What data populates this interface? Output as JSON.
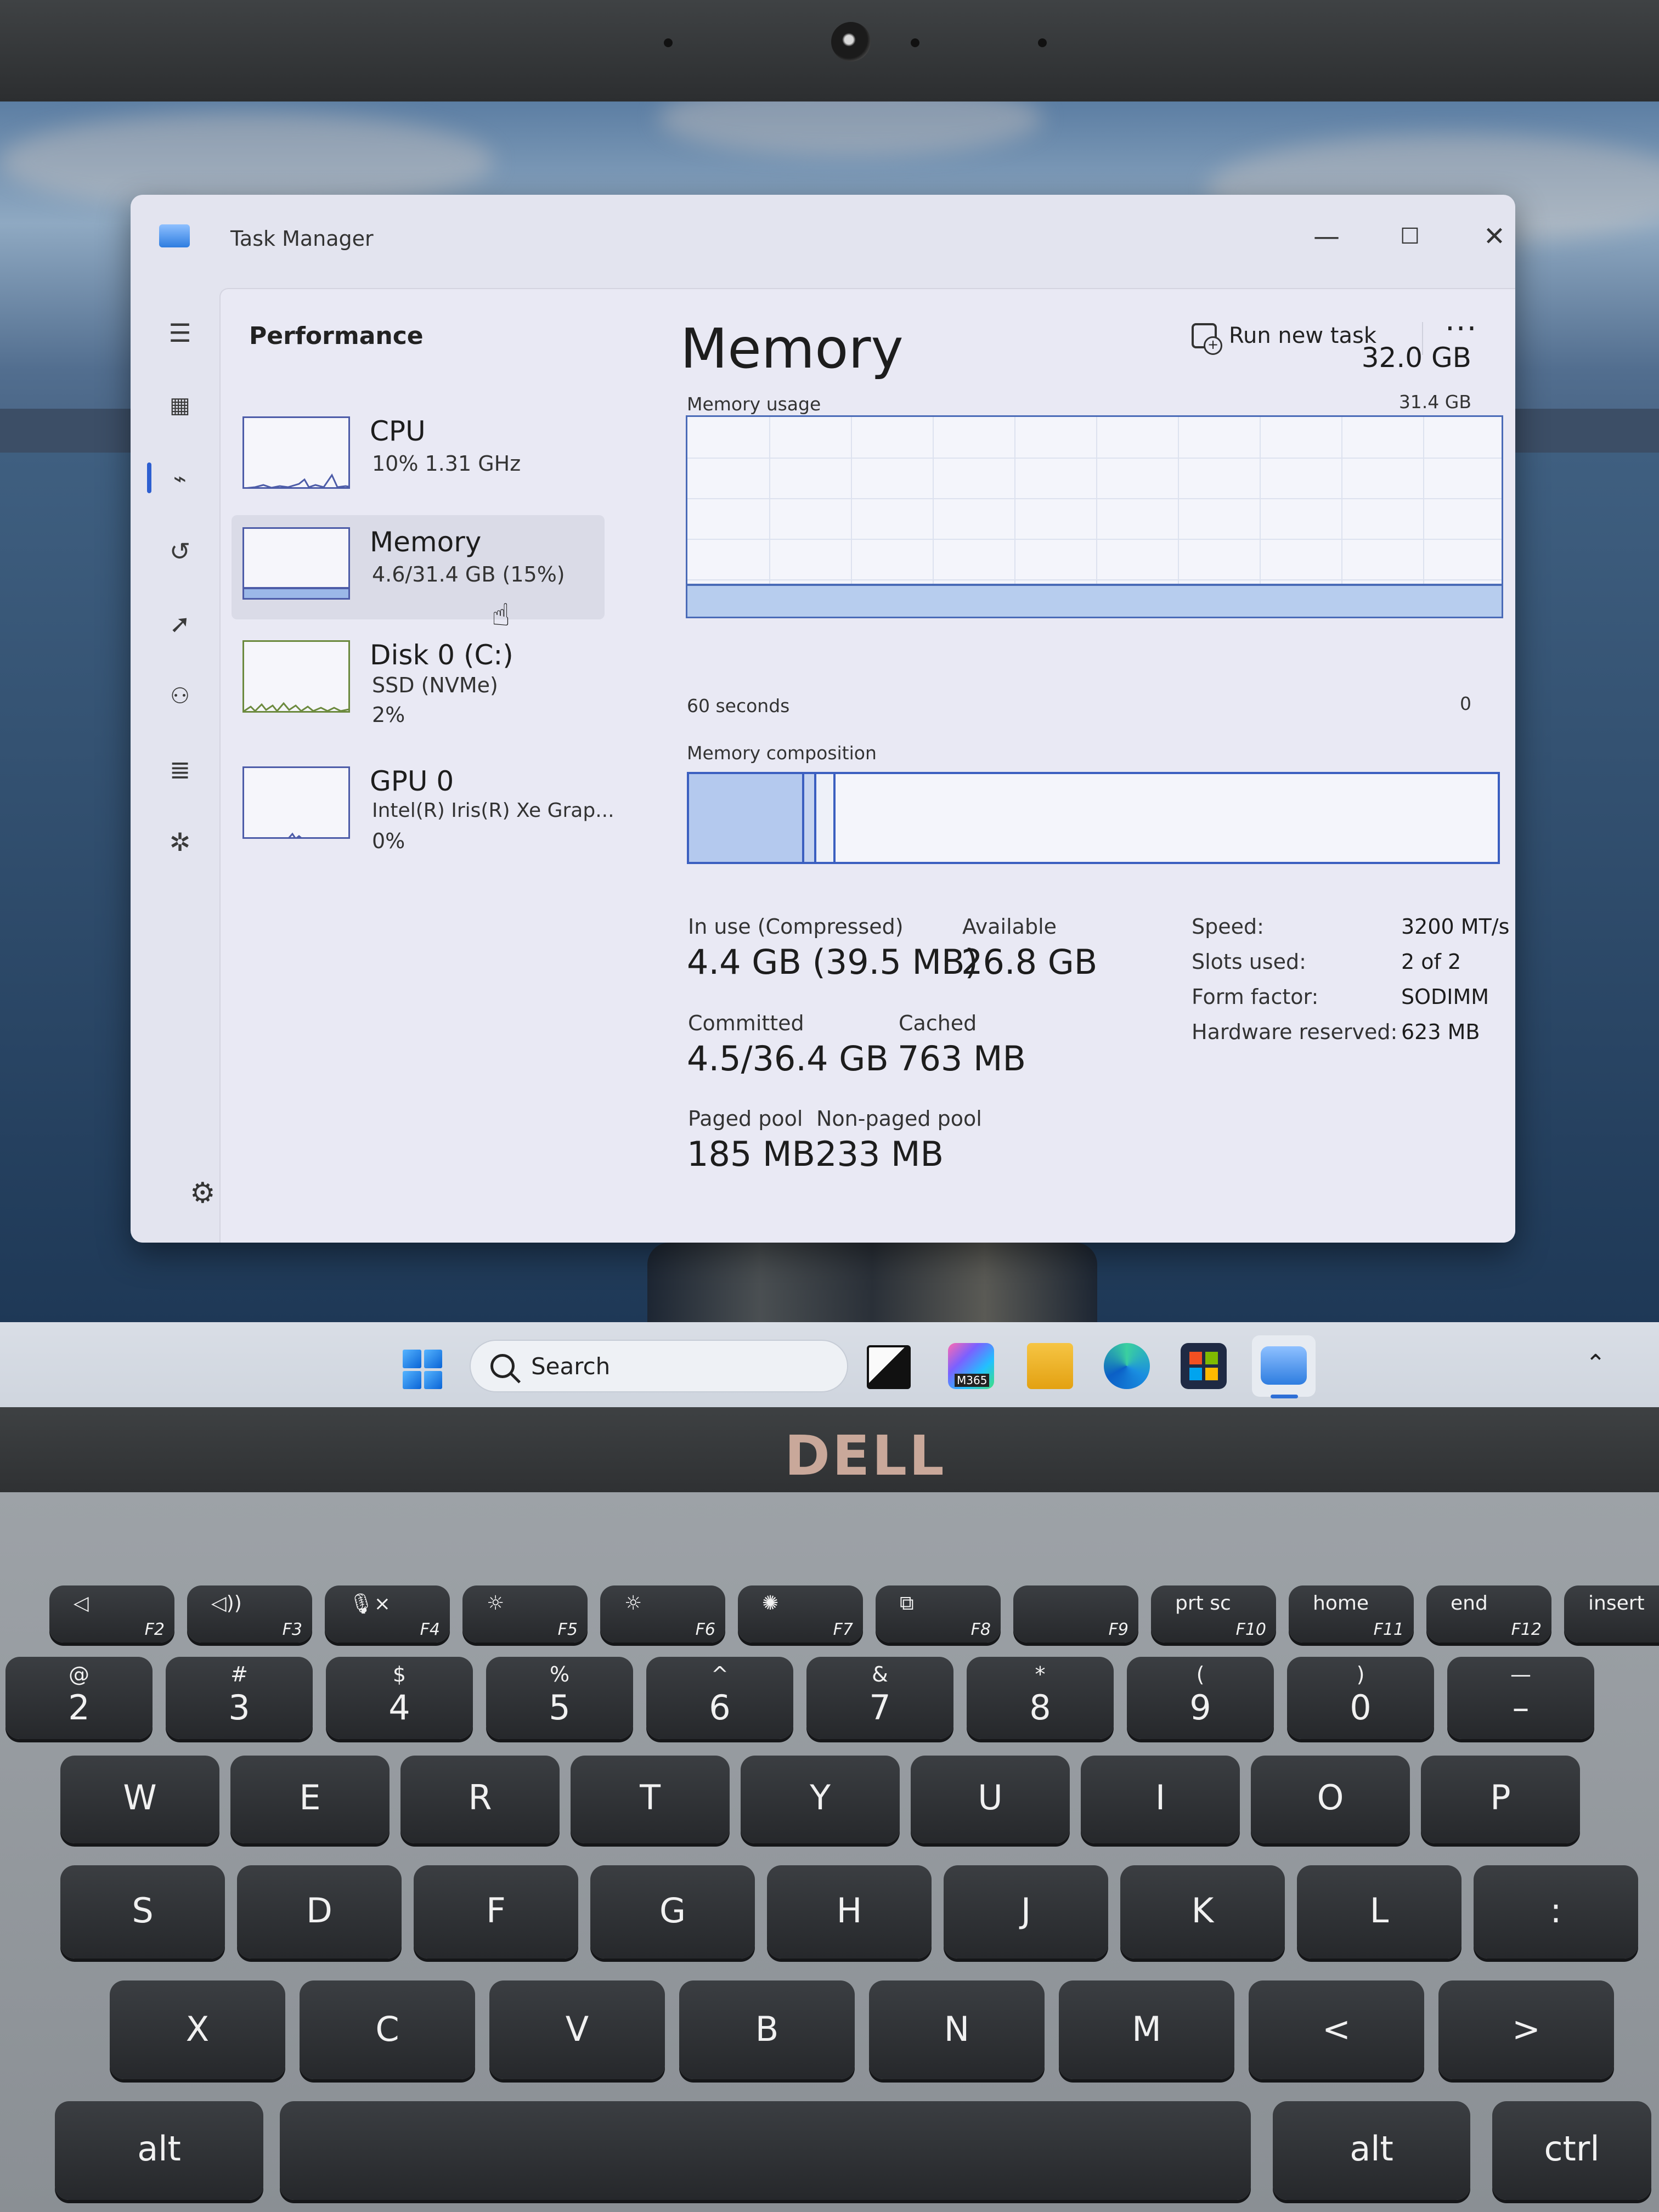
{
  "window": {
    "title": "Task Manager",
    "page": "Performance",
    "run_new_task": "Run new task",
    "more": "···",
    "minimize": "—",
    "maximize": "☐",
    "close": "✕"
  },
  "nav_icons": [
    "hamburger-menu-icon",
    "processes-icon",
    "performance-icon",
    "app-history-icon",
    "startup-apps-icon",
    "users-icon",
    "details-icon",
    "services-icon",
    "settings-icon"
  ],
  "devices": [
    {
      "name": "CPU",
      "line1": "10%  1.31 GHz",
      "line2": ""
    },
    {
      "name": "Memory",
      "line1": "4.6/31.4 GB (15%)",
      "line2": ""
    },
    {
      "name": "Disk 0 (C:)",
      "line1": "SSD (NVMe)",
      "line2": "2%"
    },
    {
      "name": "GPU 0",
      "line1": "Intel(R) Iris(R) Xe Grap...",
      "line2": "0%"
    }
  ],
  "memory": {
    "title": "Memory",
    "total": "32.0 GB",
    "usage_label": "Memory usage",
    "usage_max": "31.4 GB",
    "time_left": "60 seconds",
    "time_right": "0",
    "usage_fraction": 0.15,
    "composition_label": "Memory composition",
    "composition": {
      "in_use_fraction": 0.14,
      "modified_fraction": 0.015,
      "standby_fraction": 0.024
    },
    "stats": {
      "in_use_label": "In use (Compressed)",
      "in_use": "4.4 GB (39.5 MB)",
      "available_label": "Available",
      "available": "26.8 GB",
      "committed_label": "Committed",
      "committed": "4.5/36.4 GB",
      "cached_label": "Cached",
      "cached": "763 MB",
      "paged_label": "Paged pool",
      "paged": "185 MB",
      "nonpaged_label": "Non-paged pool",
      "nonpaged": "233 MB"
    },
    "specs": [
      {
        "label": "Speed:",
        "value": "3200 MT/s"
      },
      {
        "label": "Slots used:",
        "value": "2 of 2"
      },
      {
        "label": "Form factor:",
        "value": "SODIMM"
      },
      {
        "label": "Hardware reserved:",
        "value": "623 MB"
      }
    ]
  },
  "taskbar": {
    "search_placeholder": "Search",
    "apps": [
      "task-view-icon",
      "m365-icon",
      "file-explorer-icon",
      "edge-icon",
      "store-icon",
      "task-manager-icon"
    ],
    "m365_label": "M365"
  },
  "laptop": {
    "brand": "DELL",
    "fn_row": [
      {
        "f": "F2",
        "icon": "◁"
      },
      {
        "f": "F3",
        "icon": "◁))"
      },
      {
        "f": "F4",
        "icon": "🎙×"
      },
      {
        "f": "F5",
        "icon": "☼"
      },
      {
        "f": "F6",
        "icon": "☼"
      },
      {
        "f": "F7",
        "icon": "✺"
      },
      {
        "f": "F8",
        "icon": "⧉"
      },
      {
        "f": "F9",
        "icon": ""
      },
      {
        "f": "F10",
        "icon": "prt sc"
      },
      {
        "f": "F11",
        "icon": "home"
      },
      {
        "f": "F12",
        "icon": "end"
      },
      {
        "f": "",
        "icon": "insert"
      }
    ],
    "num_row": [
      {
        "t": "@",
        "m": "2"
      },
      {
        "t": "#",
        "m": "3"
      },
      {
        "t": "$",
        "m": "4"
      },
      {
        "t": "%",
        "m": "5"
      },
      {
        "t": "^",
        "m": "6"
      },
      {
        "t": "&",
        "m": "7"
      },
      {
        "t": "*",
        "m": "8"
      },
      {
        "t": "(",
        "m": "9"
      },
      {
        "t": ")",
        "m": "0"
      },
      {
        "t": "—",
        "m": "–"
      }
    ],
    "row_q": [
      "W",
      "E",
      "R",
      "T",
      "Y",
      "U",
      "I",
      "O",
      "P"
    ],
    "row_a": [
      "S",
      "D",
      "F",
      "G",
      "H",
      "J",
      "K",
      "L",
      ":"
    ],
    "row_z": [
      "X",
      "C",
      "V",
      "B",
      "N",
      "M",
      "<",
      ">"
    ],
    "alt_left": "alt",
    "alt_right": "alt",
    "ctrl": "ctrl"
  }
}
